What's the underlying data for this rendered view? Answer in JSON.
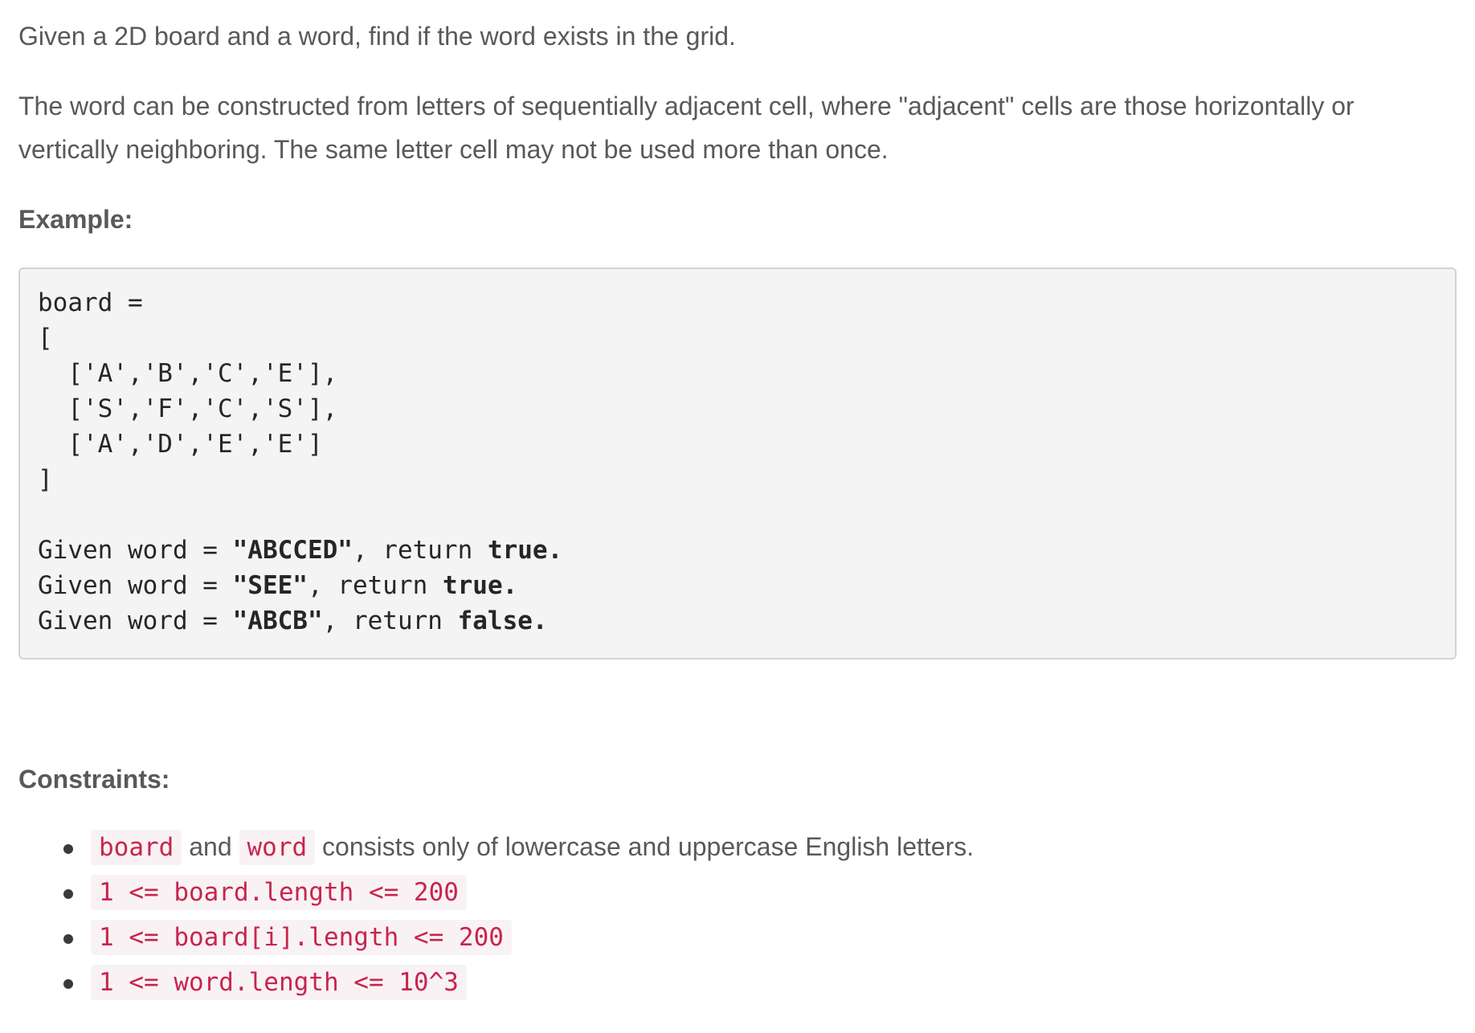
{
  "description": {
    "p1": "Given a 2D board and a word, find if the word exists in the grid.",
    "p2": "The word can be constructed from letters of sequentially adjacent cell, where \"adjacent\" cells are those horizontally or vertically neighboring. The same letter cell may not be used more than once."
  },
  "example": {
    "heading": "Example:",
    "board_lines": [
      "board =",
      "[",
      "  ['A','B','C','E'],",
      "  ['S','F','C','S'],",
      "  ['A','D','E','E']",
      "]"
    ],
    "cases": [
      {
        "prefix": "Given word = ",
        "word": "\"ABCCED\"",
        "mid": ", return ",
        "result": "true."
      },
      {
        "prefix": "Given word = ",
        "word": "\"SEE\"",
        "mid": ", return ",
        "result": "true."
      },
      {
        "prefix": "Given word = ",
        "word": "\"ABCB\"",
        "mid": ", return ",
        "result": "false."
      }
    ]
  },
  "constraints": {
    "heading": "Constraints:",
    "item1": {
      "code_a": "board",
      "text_a": " and ",
      "code_b": "word",
      "text_b": " consists only of lowercase and uppercase English letters."
    },
    "item2": "1 <= board.length <= 200",
    "item3": "1 <= board[i].length <= 200",
    "item4": "1 <= word.length <= 10^3"
  },
  "colors": {
    "text": "#595959",
    "code_text": "#c7254e",
    "code_bg": "#f9f2f4",
    "pre_bg": "#f4f4f4"
  }
}
